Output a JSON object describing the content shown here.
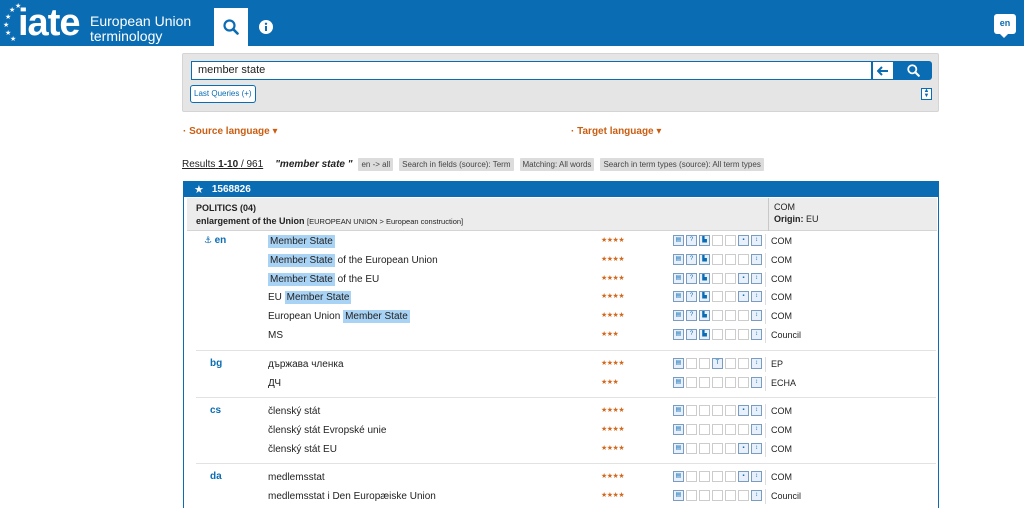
{
  "header": {
    "logo_text": "iate",
    "logo_sub": "European Union terminology",
    "lang_button": "en"
  },
  "search": {
    "value": "member state",
    "last_queries": "Last Queries (+)"
  },
  "languages": {
    "source": "Source language",
    "target": "Target language"
  },
  "results": {
    "label": "Results",
    "range": "1-10",
    "total": "/ 961",
    "query": "\"member state \"",
    "chips": [
      "en -> all",
      "Search in fields (source): Term",
      "Matching: All words",
      "Search in term types (source): All term types"
    ]
  },
  "entry": {
    "id": "1568826",
    "domain": "POLITICS (04)",
    "subdomain": "enlargement of the Union",
    "subdomain_path": "[EUROPEAN UNION > European construction]",
    "owner": "COM",
    "origin_label": "Origin:",
    "origin_value": "EU",
    "groups": [
      {
        "lang": "en",
        "terms": [
          {
            "pre": "",
            "hl": "Member State",
            "post": "",
            "stars": "★★★★",
            "src": "COM"
          },
          {
            "pre": "",
            "hl": "Member State",
            "post": " of the European Union",
            "stars": "★★★★",
            "src": "COM"
          },
          {
            "pre": "",
            "hl": "Member State",
            "post": " of the EU",
            "stars": "★★★★",
            "src": "COM"
          },
          {
            "pre": "EU ",
            "hl": "Member State",
            "post": "",
            "stars": "★★★★",
            "src": "COM"
          },
          {
            "pre": "European Union ",
            "hl": "Member State",
            "post": "",
            "stars": "★★★★",
            "src": "COM"
          },
          {
            "pre": "MS",
            "hl": "",
            "post": "",
            "stars": "★★★",
            "src": "Council"
          }
        ]
      },
      {
        "lang": "bg",
        "terms": [
          {
            "pre": "държава членка",
            "hl": "",
            "post": "",
            "stars": "★★★★",
            "src": "EP"
          },
          {
            "pre": "ДЧ",
            "hl": "",
            "post": "",
            "stars": "★★★",
            "src": "ECHA"
          }
        ]
      },
      {
        "lang": "cs",
        "terms": [
          {
            "pre": "členský stát",
            "hl": "",
            "post": "",
            "stars": "★★★★",
            "src": "COM"
          },
          {
            "pre": "členský stát Evropské unie",
            "hl": "",
            "post": "",
            "stars": "★★★★",
            "src": "COM"
          },
          {
            "pre": "členský stát EU",
            "hl": "",
            "post": "",
            "stars": "★★★★",
            "src": "COM"
          }
        ]
      },
      {
        "lang": "da",
        "terms": [
          {
            "pre": "medlemsstat",
            "hl": "",
            "post": "",
            "stars": "★★★★",
            "src": "COM"
          },
          {
            "pre": "medlemsstat i Den Europæiske Union",
            "hl": "",
            "post": "",
            "stars": "★★★★",
            "src": "Council"
          }
        ]
      }
    ]
  },
  "colors": {
    "brand": "#0a6cb3",
    "accent": "#c95e12",
    "highlight": "#a9d3f5"
  }
}
